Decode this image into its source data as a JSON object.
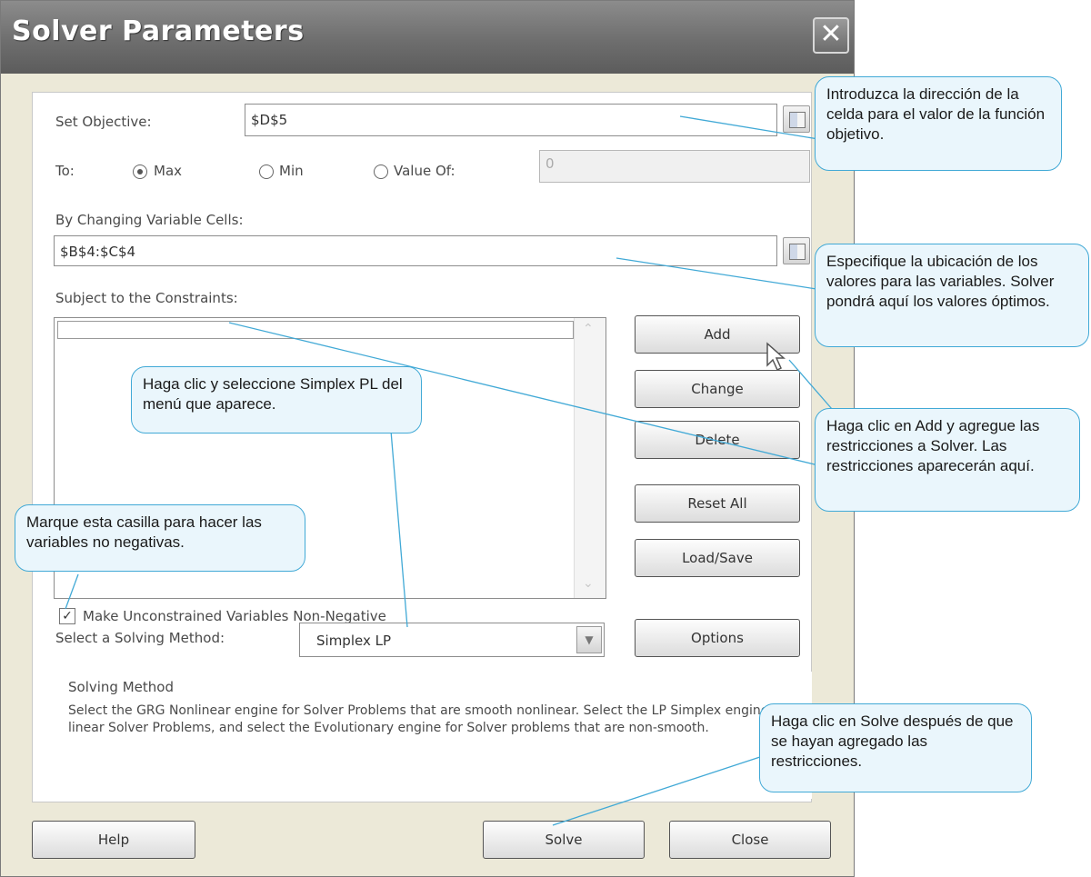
{
  "window": {
    "title": "Solver Parameters",
    "close_label": "✕"
  },
  "objective": {
    "label": "Set Objective:",
    "value": "$D$5"
  },
  "to": {
    "label": "To:",
    "options": [
      "Max",
      "Min",
      "Value Of:"
    ],
    "selected": "Max",
    "value_of": "0"
  },
  "changing": {
    "label": "By Changing Variable Cells:",
    "value": "$B$4:$C$4"
  },
  "constraints": {
    "label": "Subject to the Constraints:"
  },
  "buttons": {
    "add": "Add",
    "change": "Change",
    "delete": "Delete",
    "reset_all": "Reset All",
    "load_save": "Load/Save",
    "options": "Options",
    "help": "Help",
    "solve": "Solve",
    "close": "Close"
  },
  "nonneg": {
    "label": "Make Unconstrained Variables Non-Negative",
    "checked": true
  },
  "method": {
    "label": "Select a Solving Method:",
    "value": "Simplex LP"
  },
  "method_box": {
    "title": "Solving Method",
    "description": "Select the GRG Nonlinear engine for Solver Problems that are smooth nonlinear. Select the LP Simplex engine for linear Solver Problems, and select the Evolutionary engine for Solver problems that are non-smooth."
  },
  "callouts": {
    "objective": "Introduzca la dirección de la celda para el valor de la función objetivo.",
    "variables": "Especifique la ubicación de los valores para las variables. Solver pondrá aquí los valores óptimos.",
    "simplex": "Haga clic y seleccione Simplex PL del menú que aparece.",
    "add": "Haga clic en Add y agregue las restricciones a Solver. Las restricciones aparecerán aquí.",
    "nonneg": "Marque esta casilla para hacer las variables no negativas.",
    "solve": "Haga clic en Solve después de que se hayan agregado las restricciones."
  },
  "colors": {
    "callout_border": "#41a9d6",
    "callout_fill": "#eaf6fc",
    "titlebar": "#6e6e6e"
  }
}
